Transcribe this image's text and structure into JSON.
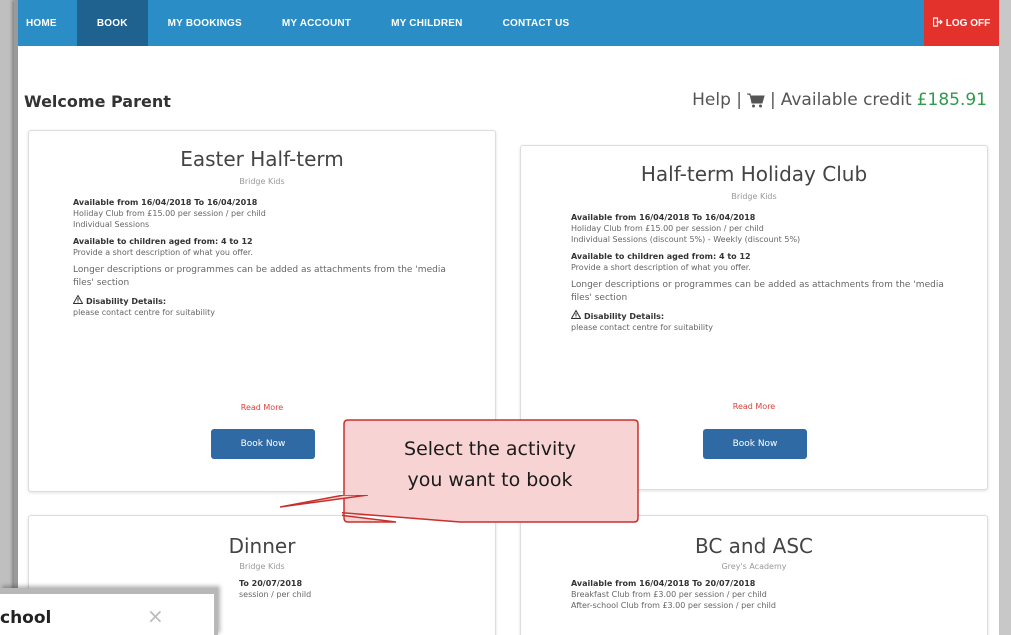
{
  "nav": {
    "items": [
      {
        "label": "HOME",
        "active": false
      },
      {
        "label": "BOOK",
        "active": true
      },
      {
        "label": "MY BOOKINGS",
        "active": false
      },
      {
        "label": "MY ACCOUNT",
        "active": false
      },
      {
        "label": "MY CHILDREN",
        "active": false
      },
      {
        "label": "CONTACT US",
        "active": false
      }
    ],
    "logoff_label": "LOG OFF",
    "logoff_icon": "logout-icon"
  },
  "header": {
    "welcome": "Welcome Parent",
    "help": "Help |",
    "separator": "|",
    "credit_label": "Available credit",
    "credit_amount": "£185.91"
  },
  "cards": [
    {
      "title": "Easter Half-term",
      "provider": "Bridge Kids",
      "available": "Available from 16/04/2018 To 16/04/2018",
      "price": "Holiday Club from £15.00 per session / per child",
      "sessions": "Individual Sessions",
      "ages": "Available to children aged from: 4 to 12",
      "short_desc": "Provide a short description of what you offer.",
      "long_desc": "Longer descriptions or programmes can be added as attachments from the 'media files' section",
      "disability_label": "Disability Details:",
      "disability_text": "please contact centre for suitability",
      "read_more": "Read More",
      "book_label": "Book Now"
    },
    {
      "title": "Half-term Holiday Club",
      "provider": "Bridge Kids",
      "available": "Available from 16/04/2018 To 16/04/2018",
      "price": "Holiday Club from £15.00 per session / per child",
      "sessions": "Individual Sessions (discount 5%) - Weekly (discount 5%)",
      "ages": "Available to children aged from: 4 to 12",
      "short_desc": "Provide a short description of what you offer.",
      "long_desc": "Longer descriptions or programmes can be added as attachments from the 'media files' section",
      "disability_label": "Disability Details:",
      "disability_text": "please contact centre for suitability",
      "read_more": "Read More",
      "book_label": "Book Now"
    },
    {
      "title": "Dinner",
      "provider": "Bridge Kids",
      "available": "To 20/07/2018",
      "price": "session / per child"
    },
    {
      "title": "BC and ASC",
      "provider": "Grey's Academy",
      "available": "Available from 16/04/2018 To 20/07/2018",
      "price": "Breakfast Club from £3.00 per session / per child",
      "sessions": "After-school Club from £3.00 per session / per child"
    }
  ],
  "callout": {
    "line1": "Select the activity",
    "line2": "you want to book"
  },
  "overlay": {
    "title": "chool",
    "close": "×"
  },
  "colors": {
    "navbar": "#2a8dc6",
    "nav_active": "#20628f",
    "logoff": "#e3322c",
    "credit": "#2e9b4a",
    "button": "#2f6aa4",
    "read_more": "#d9443b",
    "callout_fill": "#f8d3d3",
    "callout_border": "#c9302c"
  }
}
